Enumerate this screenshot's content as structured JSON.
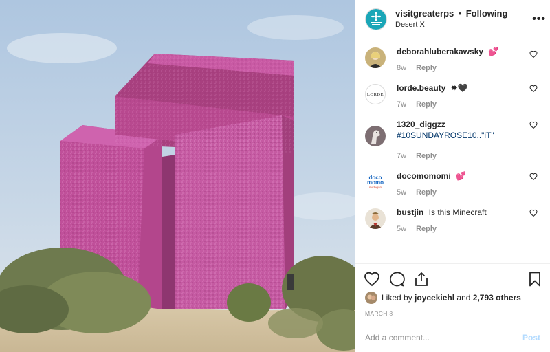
{
  "post": {
    "username": "visitgreaterps",
    "separator": "•",
    "follow_state": "Following",
    "location": "Desert X",
    "more_label": "•••"
  },
  "comments": [
    {
      "username": "deborahluberakawsky",
      "text": "💕",
      "age": "8w",
      "reply": "Reply"
    },
    {
      "username": "lorde.beauty",
      "text": "✸🖤",
      "age": "7w",
      "reply": "Reply",
      "avatar_text": "LORDE"
    },
    {
      "username": "1320_diggzz",
      "tag": "#10SUNDAYROSE10..\"iT\"",
      "age": "7w",
      "reply": "Reply"
    },
    {
      "username": "docomomomi",
      "text": "💕",
      "age": "5w",
      "reply": "Reply",
      "avatar_text": [
        "doco",
        "momo",
        "michigan"
      ]
    },
    {
      "username": "bustjin",
      "text": "Is this Minecraft",
      "age": "5w",
      "reply": "Reply"
    }
  ],
  "likes": {
    "prefix": "Liked by",
    "user": "joycekiehl",
    "and": "and",
    "count": "2,793 others"
  },
  "date": "MARCH 8",
  "add_comment": {
    "placeholder": "Add a comment...",
    "post_label": "Post"
  },
  "icons": [
    "heart-icon",
    "comment-icon",
    "share-icon",
    "bookmark-icon"
  ],
  "colors": {
    "sculpture_pink": "#c0509a",
    "sky": "#b9cde3",
    "link": "#003569",
    "post_disabled": "#b3dbff"
  }
}
